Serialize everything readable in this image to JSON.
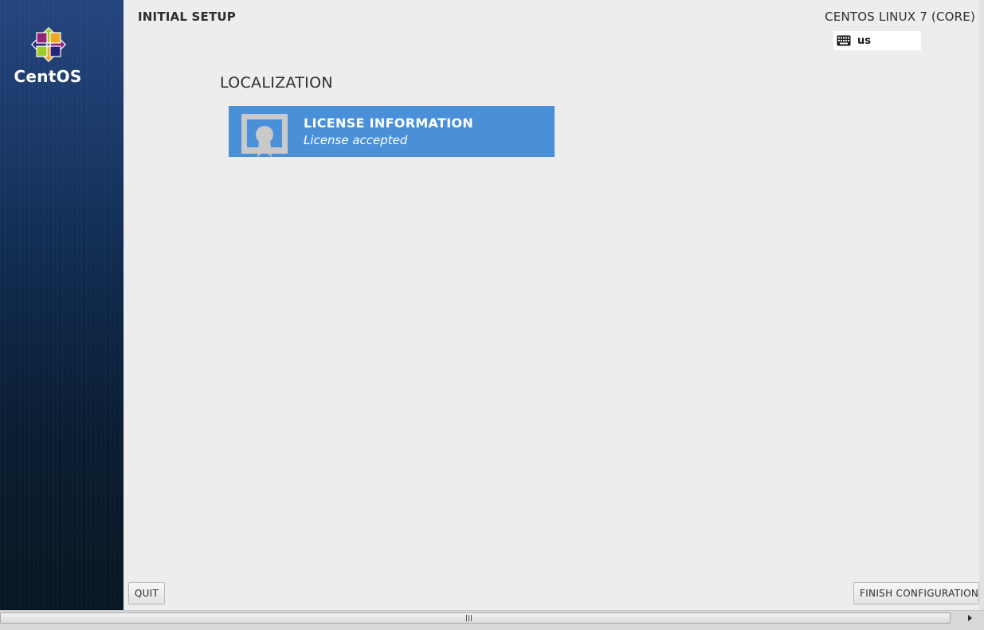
{
  "sidebar": {
    "brand": "CentOS"
  },
  "header": {
    "setup_title": "INITIAL SETUP",
    "product_title": "CENTOS LINUX 7 (CORE)",
    "keyboard_layout": "us"
  },
  "main": {
    "section_title": "LOCALIZATION",
    "spoke": {
      "title": "LICENSE INFORMATION",
      "status": "License accepted"
    }
  },
  "footer": {
    "quit_label": "QUIT",
    "finish_label": "FINISH CONFIGURATION"
  },
  "colors": {
    "accent": "#4a90d9",
    "sidebar_top": "#25457e",
    "sidebar_bottom": "#081722",
    "background": "#ededed"
  },
  "icons": {
    "logo": "centos-logo-icon",
    "keyboard": "keyboard-icon",
    "license": "license-certificate-icon",
    "scroll_grip": "scroll-grip-icon",
    "scroll_right": "arrow-right-icon"
  }
}
